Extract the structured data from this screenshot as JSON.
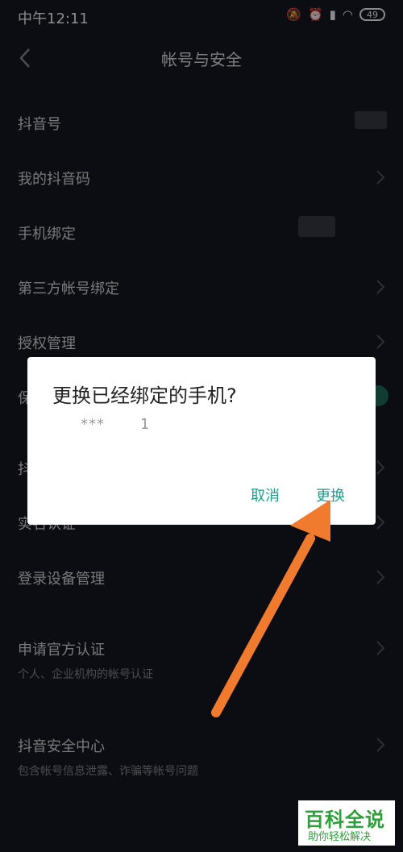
{
  "status": {
    "time": "中午12:11",
    "battery": "49"
  },
  "header": {
    "title": "帐号与安全"
  },
  "rows": [
    {
      "label": "抖音号"
    },
    {
      "label": "我的抖音码"
    },
    {
      "label": "手机绑定"
    },
    {
      "label": "第三方帐号绑定"
    },
    {
      "label": "授权管理"
    },
    {
      "label": "保"
    },
    {
      "label": "抖"
    },
    {
      "label": "实名认证"
    },
    {
      "label": "登录设备管理"
    },
    {
      "label": "申请官方认证",
      "sub": "个人、企业机构的帐号认证"
    },
    {
      "label": "抖音安全中心",
      "sub": "包含帐号信息泄露、诈骗等帐号问题"
    }
  ],
  "dialog": {
    "title": "更换已经绑定的手机?",
    "phone_masked": "***",
    "phone_tail": "1",
    "cancel_label": "取消",
    "confirm_label": "更换"
  },
  "watermark": {
    "main": "百科全说",
    "sub": "助你轻松解决"
  },
  "colors": {
    "background": "#161823",
    "accent": "#1f9c8a",
    "arrow": "#f07b2e"
  }
}
